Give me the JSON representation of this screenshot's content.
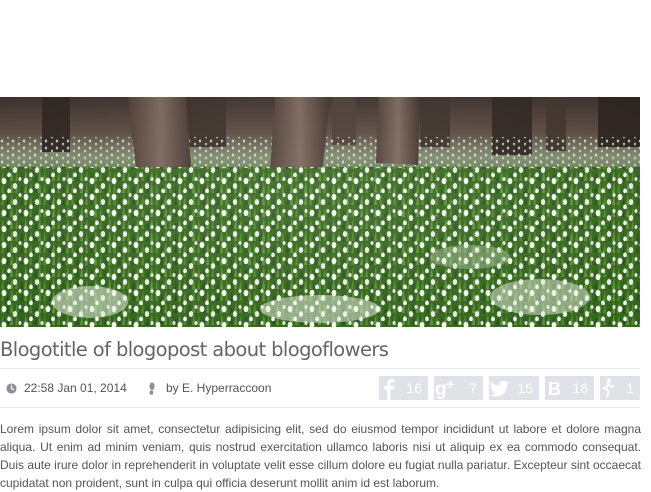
{
  "post": {
    "title": "Blogotitle of blogopost about blogoflowers",
    "meta": {
      "datetime": "22:58 Jan 01, 2014",
      "author": "by E. Hyperraccoon"
    },
    "shares": [
      {
        "network": "facebook",
        "icon": "facebook-icon",
        "count": "16"
      },
      {
        "network": "google-plus",
        "icon": "google-plus-icon",
        "count": "7"
      },
      {
        "network": "twitter",
        "icon": "twitter-bird-icon",
        "count": "15"
      },
      {
        "network": "vkontakte",
        "icon": "vk-icon",
        "count": "16"
      },
      {
        "network": "rating",
        "icon": "person-walking-icon",
        "count": "1"
      }
    ],
    "body": "Lorem ipsum dolor sit amet, consectetur adipisicing elit, sed do eiusmod tempor incididunt ut labore et dolore magna aliqua. Ut enim ad minim veniam, quis nostrud exercitation ullamco laboris nisi ut aliquip ex ea commodo consequat. Duis aute irure dolor in reprehenderit in voluptate velit esse cillum dolore eu fugiat nulla pariatur. Excepteur sint occaecat cupidatat non proident, sunt in culpa qui officia deserunt mollit anim id est laborum."
  },
  "colors": {
    "share_button_bg": "#dfe3e7",
    "title": "#656565",
    "text": "#555555",
    "divider": "#e6e6e6"
  }
}
